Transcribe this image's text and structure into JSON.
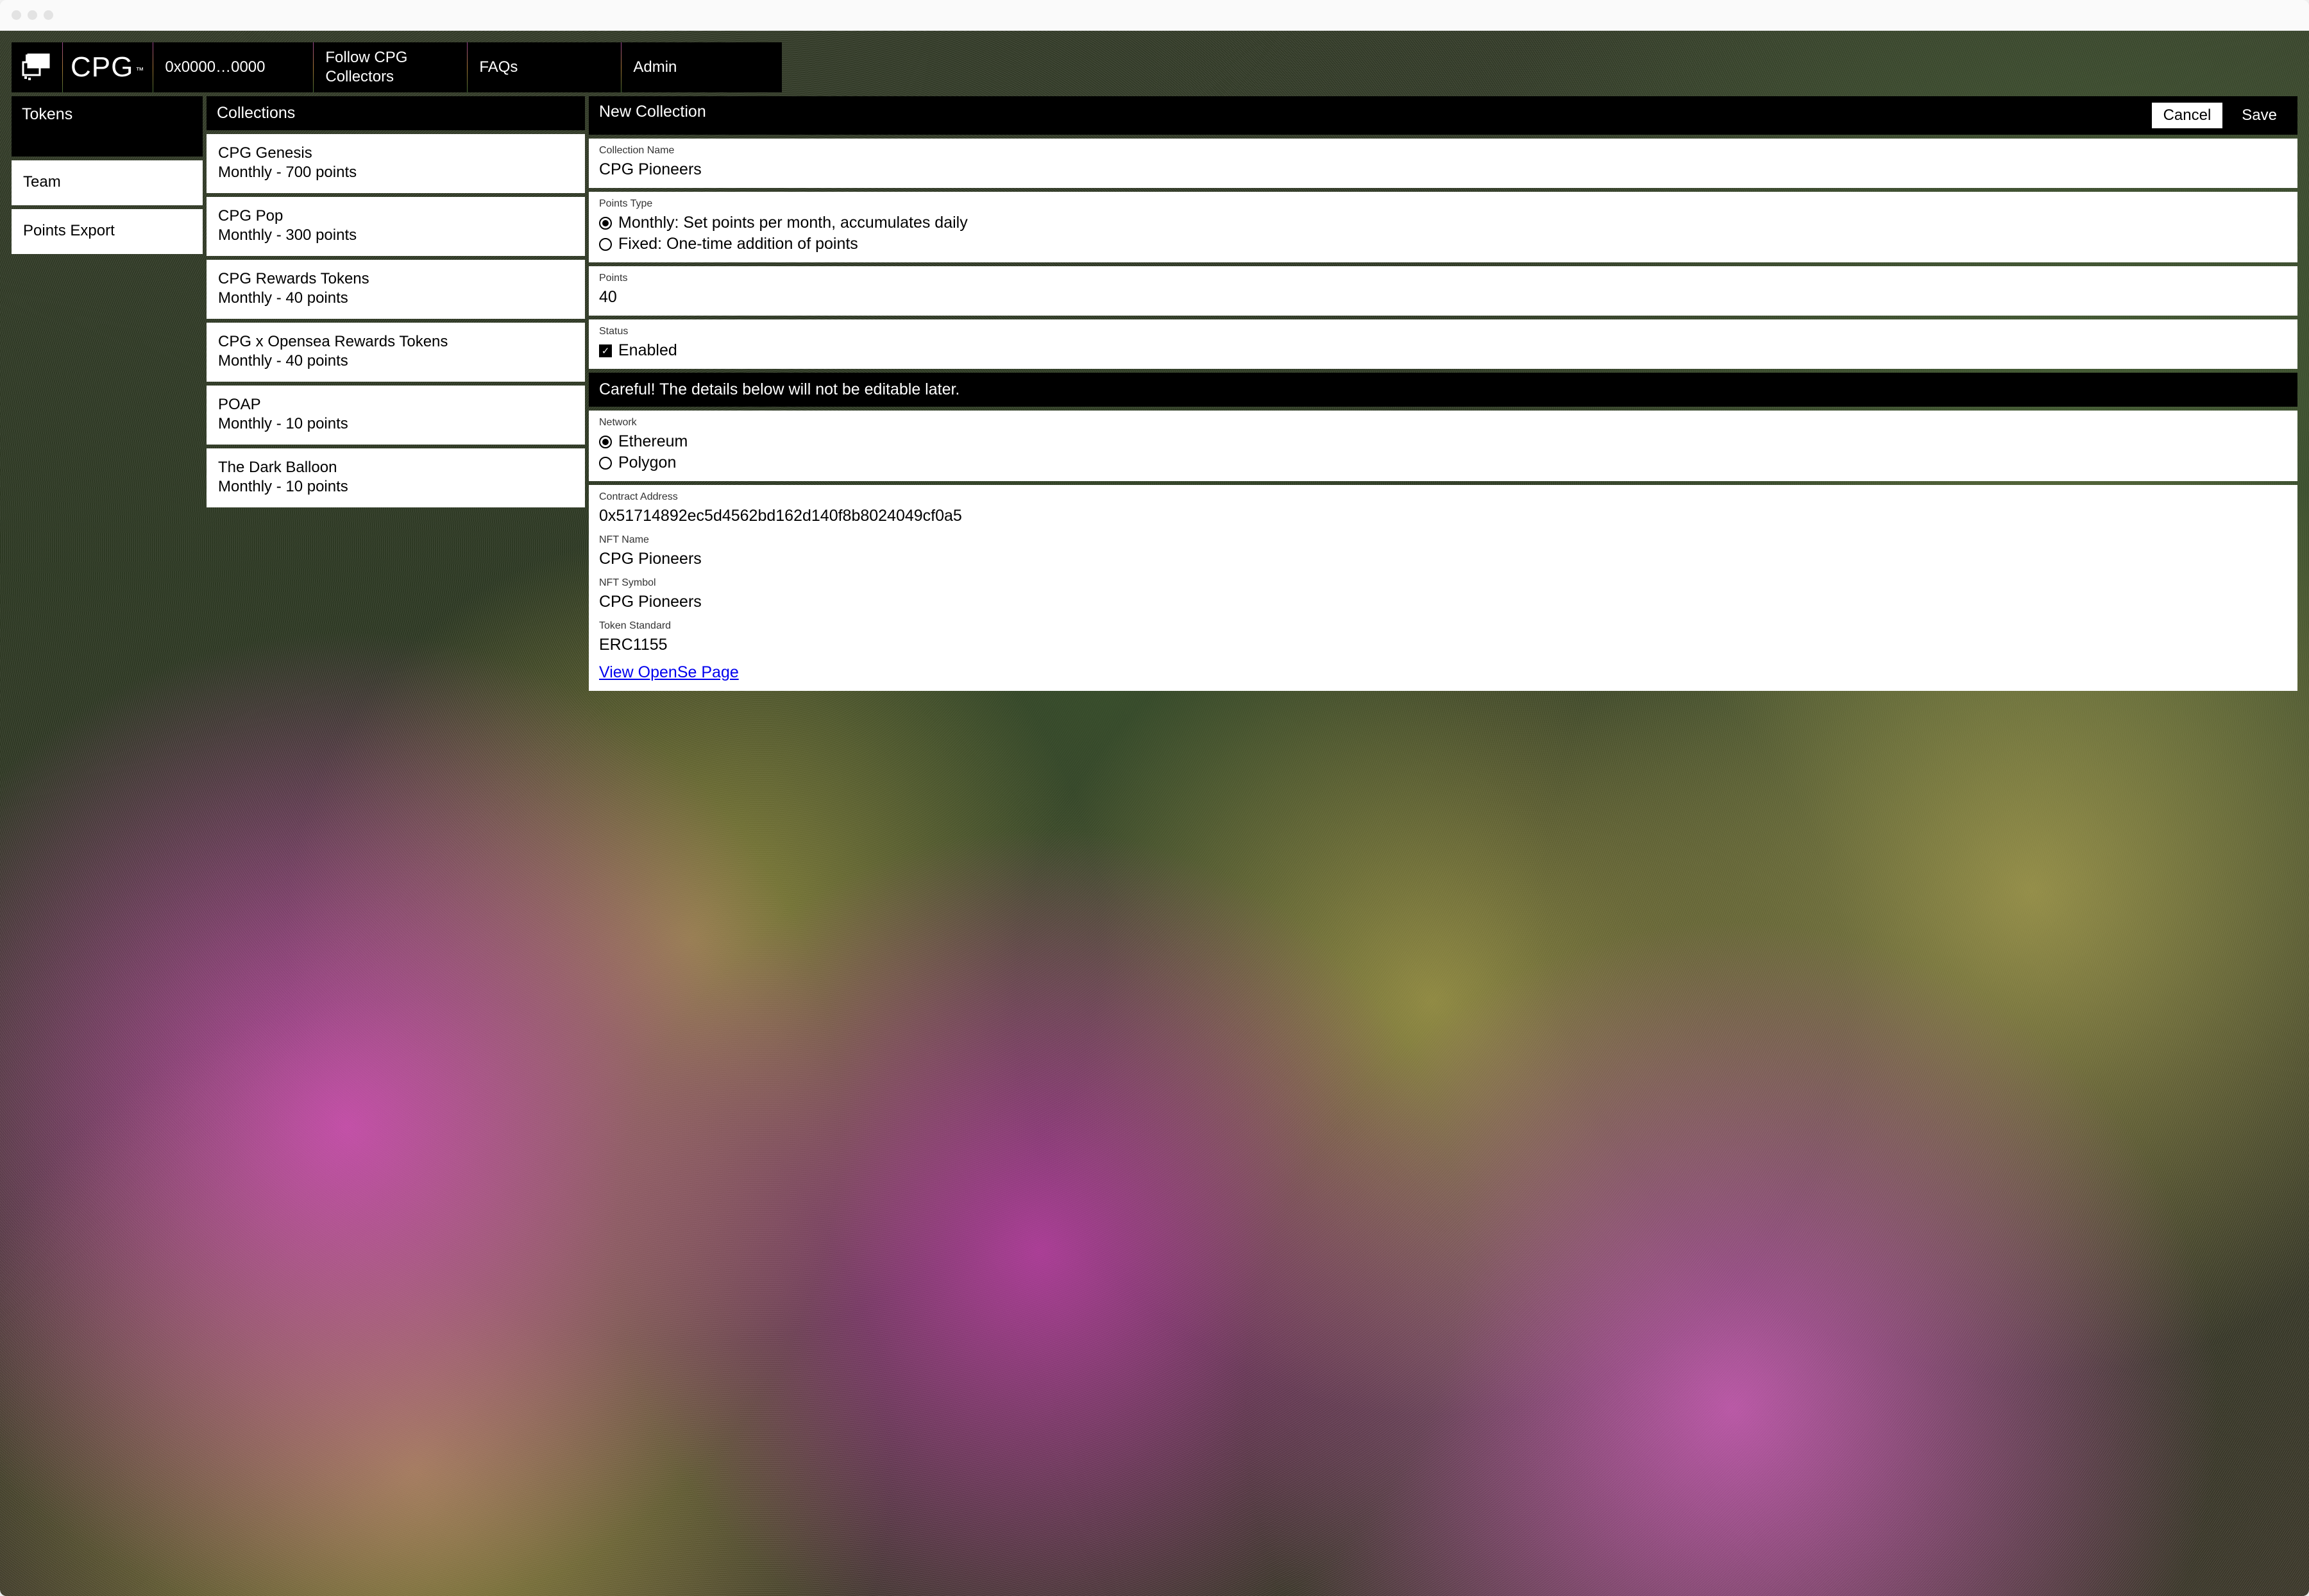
{
  "nav": {
    "brand": "CPG",
    "trademark": "™",
    "wallet": "0x0000…0000",
    "follow_line1": "Follow CPG",
    "follow_line2": "Collectors",
    "faqs": "FAQs",
    "admin": "Admin"
  },
  "sidebar": {
    "tokens": "Tokens",
    "team": "Team",
    "points_export": "Points Export"
  },
  "collections": {
    "header": "Collections",
    "items": [
      {
        "name": "CPG Genesis",
        "sub": "Monthly - 700 points"
      },
      {
        "name": "CPG Pop",
        "sub": "Monthly - 300 points"
      },
      {
        "name": "CPG Rewards Tokens",
        "sub": "Monthly - 40 points"
      },
      {
        "name": "CPG x Opensea Rewards Tokens",
        "sub": "Monthly - 40 points"
      },
      {
        "name": "POAP",
        "sub": "Monthly - 10 points"
      },
      {
        "name": "The Dark Balloon",
        "sub": "Monthly - 10 points"
      }
    ]
  },
  "form": {
    "header": "New Collection",
    "cancel": "Cancel",
    "save": "Save",
    "collection_name_label": "Collection Name",
    "collection_name_value": "CPG Pioneers",
    "points_type_label": "Points Type",
    "points_type_monthly": "Monthly: Set points per month, accumulates daily",
    "points_type_fixed": "Fixed: One-time addition of points",
    "points_label": "Points",
    "points_value": "40",
    "status_label": "Status",
    "status_enabled": "Enabled",
    "warning": "Careful! The details below will not be editable later.",
    "network_label": "Network",
    "network_eth": "Ethereum",
    "network_poly": "Polygon",
    "contract_address_label": "Contract Address",
    "contract_address_value": "0x51714892ec5d4562bd162d140f8b8024049cf0a5",
    "nft_name_label": "NFT Name",
    "nft_name_value": "CPG Pioneers",
    "nft_symbol_label": "NFT Symbol",
    "nft_symbol_value": "CPG Pioneers",
    "token_standard_label": "Token Standard",
    "token_standard_value": "ERC1155",
    "opensea_link": "View OpenSe Page"
  }
}
